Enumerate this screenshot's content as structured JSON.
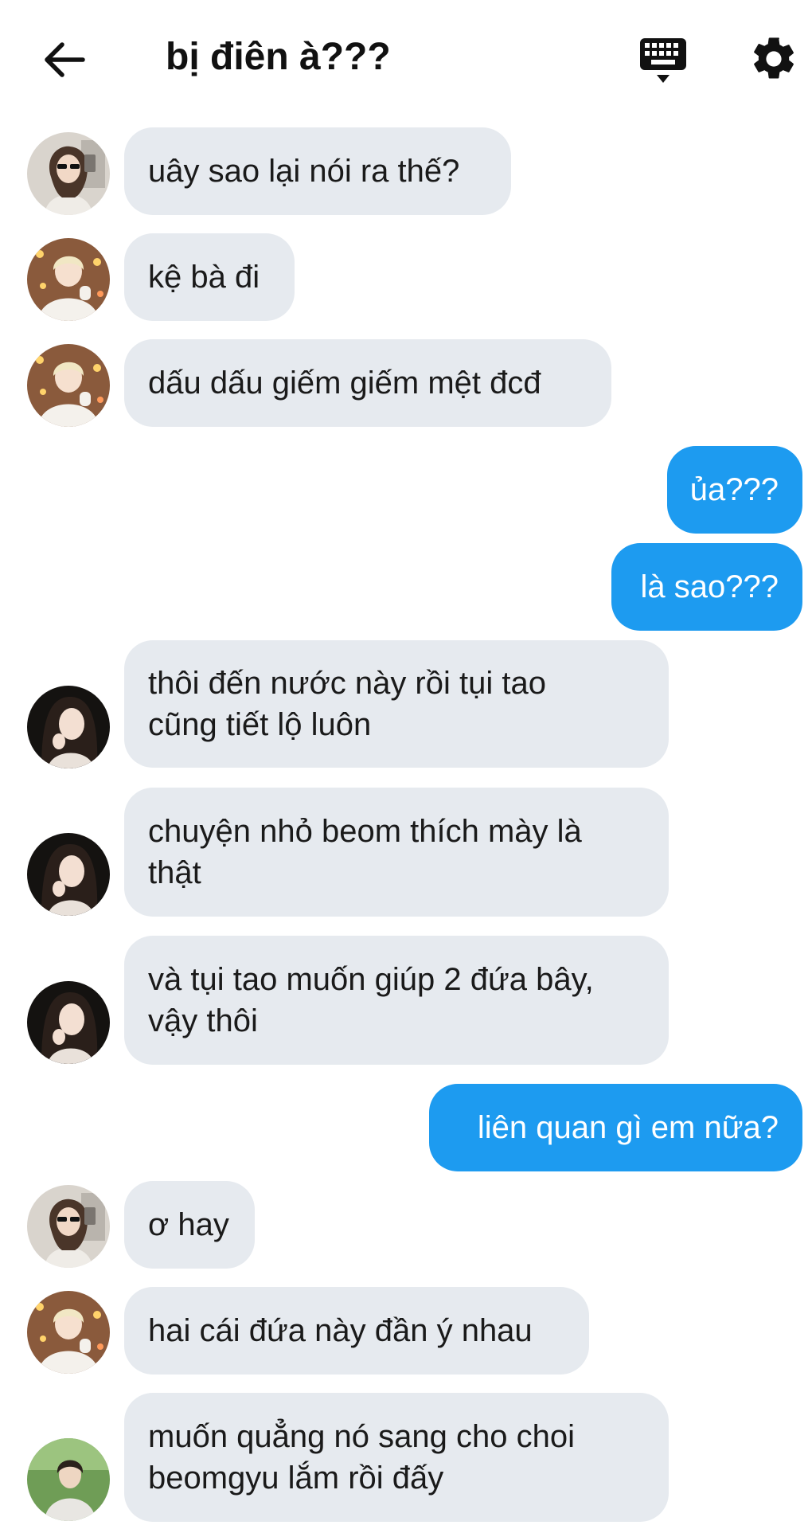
{
  "header": {
    "title": "bị điên à???",
    "back_icon": "arrow-left-icon",
    "keyboard_icon": "keyboard-icon",
    "settings_icon": "gear-icon"
  },
  "colors": {
    "incoming_bubble": "#e6eaef",
    "outgoing_bubble": "#1d9bf0",
    "outgoing_text": "#ffffff",
    "incoming_text": "#1a1a1a"
  },
  "messages": [
    {
      "direction": "in",
      "avatar": "girl-sunglasses-avatar",
      "lines": [
        "uây sao lại nói ra thế?"
      ]
    },
    {
      "direction": "in",
      "avatar": "blond-boy-avatar",
      "lines": [
        "kệ bà đi"
      ]
    },
    {
      "direction": "in",
      "avatar": "blond-boy-avatar",
      "lines": [
        "dấu dấu giếm giếm mệt đcđ"
      ]
    },
    {
      "direction": "out",
      "lines": [
        "ủa???"
      ]
    },
    {
      "direction": "out",
      "lines": [
        "là sao???"
      ]
    },
    {
      "direction": "in",
      "avatar": "dark-hair-girl-avatar",
      "lines": [
        "thôi đến nước này rồi tụi tao",
        "cũng tiết lộ luôn"
      ]
    },
    {
      "direction": "in",
      "avatar": "dark-hair-girl-avatar",
      "lines": [
        "chuyện nhỏ beom thích mày là",
        "thật"
      ]
    },
    {
      "direction": "in",
      "avatar": "dark-hair-girl-avatar",
      "lines": [
        "và tụi tao muốn giúp 2 đứa bây,",
        "vậy thôi"
      ]
    },
    {
      "direction": "out",
      "lines": [
        "liên quan gì em nữa?"
      ]
    },
    {
      "direction": "in",
      "avatar": "girl-sunglasses-avatar",
      "lines": [
        "ơ hay"
      ]
    },
    {
      "direction": "in",
      "avatar": "blond-boy-avatar",
      "lines": [
        "hai cái đứa này đần ý nhau"
      ]
    },
    {
      "direction": "in",
      "avatar": "outdoor-boy-avatar",
      "lines": [
        "muốn quẳng nó sang cho choi",
        "beomgyu lắm rồi đấy"
      ]
    }
  ]
}
